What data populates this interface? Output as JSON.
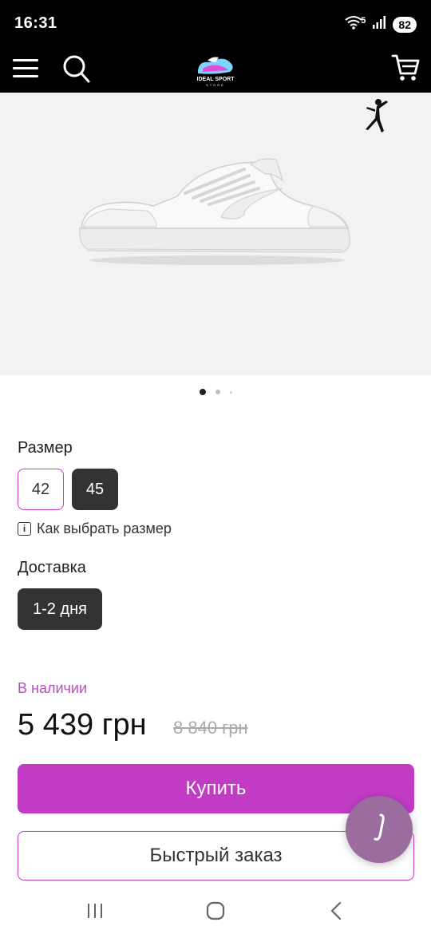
{
  "status_bar": {
    "time": "16:31",
    "network": "5",
    "battery": "82"
  },
  "header": {
    "logo_line1": "IDEAL SPORT",
    "logo_line2": "STORE",
    "icons": [
      "menu-icon",
      "search-icon",
      "cart-icon"
    ]
  },
  "gallery": {
    "image_count": 3,
    "active_index": 0
  },
  "size": {
    "label": "Размер",
    "options": [
      "42",
      "45"
    ],
    "selected": "45",
    "how_to_choose": "Как выбрать размер"
  },
  "delivery": {
    "label": "Доставка",
    "option": "1-2 дня"
  },
  "product": {
    "availability": "В наличии",
    "price": "5 439 грн",
    "old_price": "8 840 грн"
  },
  "actions": {
    "buy": "Купить",
    "quick_order": "Быстрый заказ"
  },
  "colors": {
    "accent": "#c13bc5",
    "dark_button": "#333333",
    "availability": "#b54dc0",
    "fab": "#9b6d9e"
  }
}
